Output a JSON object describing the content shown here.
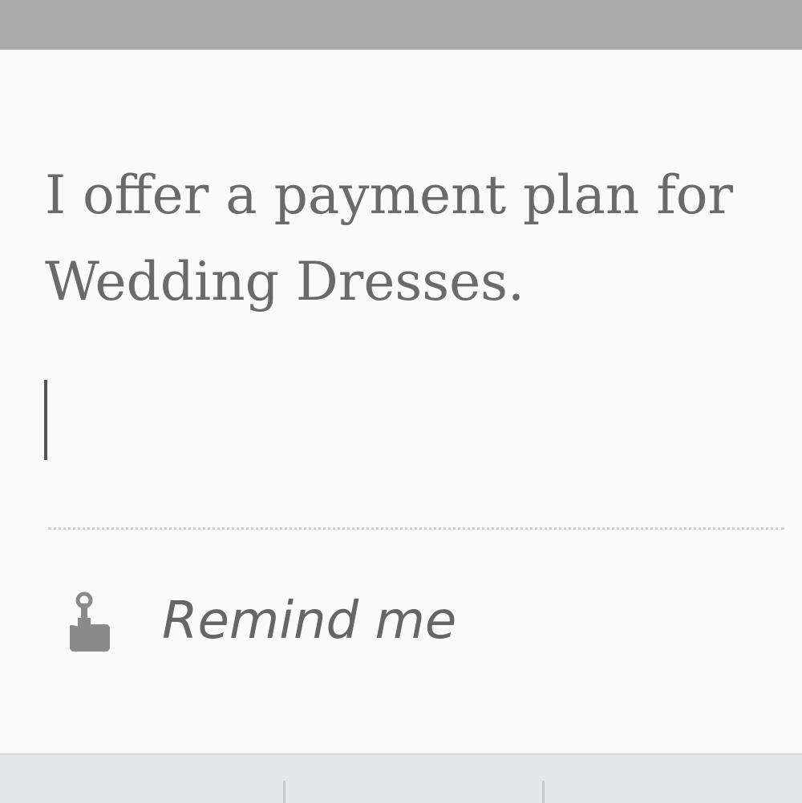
{
  "note": {
    "text": "I offer a payment plan for\nWedding Dresses."
  },
  "reminder": {
    "label": "Remind me",
    "icon": "finger-string-icon"
  },
  "colors": {
    "top_bar": "#aaaaaa",
    "background": "#fafafa",
    "text": "#6a6a6a",
    "keyboard": "#e4e8e8"
  }
}
